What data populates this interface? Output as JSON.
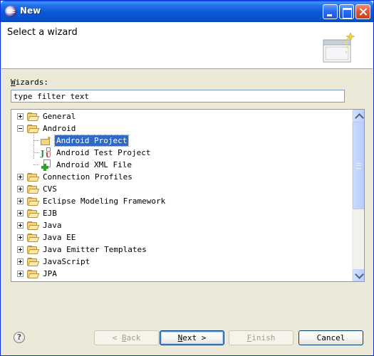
{
  "window": {
    "title": "New"
  },
  "header": {
    "title": "Select a wizard"
  },
  "wizards": {
    "label_mnemonic": "W",
    "label_rest": "izards:",
    "filter_value": "type filter text"
  },
  "tree": {
    "items": [
      {
        "label": "General",
        "level": 0,
        "expander": "plus",
        "icon": "folder-icon"
      },
      {
        "label": "Android",
        "level": 0,
        "expander": "minus",
        "icon": "folder-icon"
      },
      {
        "label": "Android Project",
        "level": 1,
        "icon": "android-project-icon",
        "selected": true
      },
      {
        "label": "Android Test Project",
        "level": 1,
        "icon": "junit-test-icon"
      },
      {
        "label": "Android XML File",
        "level": 1,
        "icon": "new-xml-file-icon"
      },
      {
        "label": "Connection Profiles",
        "level": 0,
        "expander": "plus",
        "icon": "folder-icon"
      },
      {
        "label": "CVS",
        "level": 0,
        "expander": "plus",
        "icon": "folder-icon"
      },
      {
        "label": "Eclipse Modeling Framework",
        "level": 0,
        "expander": "plus",
        "icon": "folder-icon"
      },
      {
        "label": "EJB",
        "level": 0,
        "expander": "plus",
        "icon": "folder-icon"
      },
      {
        "label": "Java",
        "level": 0,
        "expander": "plus",
        "icon": "folder-icon"
      },
      {
        "label": "Java EE",
        "level": 0,
        "expander": "plus",
        "icon": "folder-icon"
      },
      {
        "label": "Java Emitter Templates",
        "level": 0,
        "expander": "plus",
        "icon": "folder-icon"
      },
      {
        "label": "JavaScript",
        "level": 0,
        "expander": "plus",
        "icon": "folder-icon"
      },
      {
        "label": "JPA",
        "level": 0,
        "expander": "plus",
        "icon": "folder-icon"
      }
    ]
  },
  "buttons": {
    "back": {
      "prefix": "< ",
      "mnemonic": "B",
      "rest": "ack"
    },
    "next": {
      "mnemonic": "N",
      "rest": "ext >"
    },
    "finish": {
      "mnemonic": "F",
      "rest": "inish"
    },
    "cancel": {
      "label": "Cancel"
    },
    "help": "?"
  },
  "colors": {
    "selection": "#316ac5",
    "titlebar": "#0b58d8",
    "dialog_bg": "#ece9d8"
  }
}
